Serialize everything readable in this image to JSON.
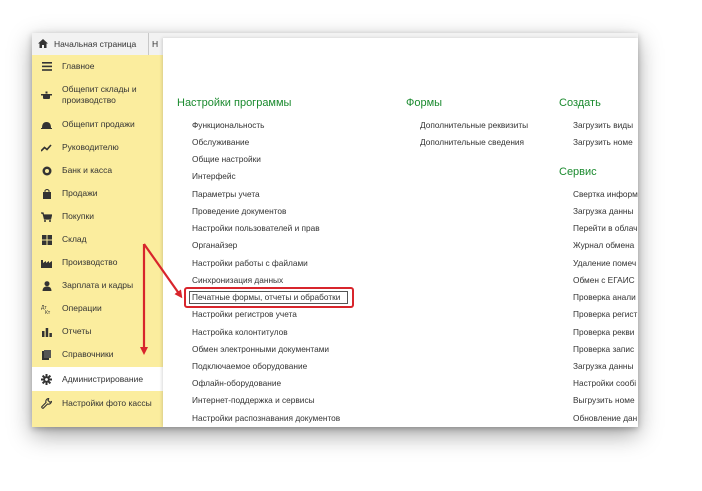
{
  "tabs": {
    "home": "Начальная страница",
    "next": "Н"
  },
  "sidebar": {
    "items": [
      {
        "label": "Главное",
        "icon": "menu-lines-icon"
      },
      {
        "label": "Общепит склады и производство",
        "icon": "cooking-pot-icon"
      },
      {
        "label": "Общепит продажи",
        "icon": "serving-dish-icon"
      },
      {
        "label": "Руководителю",
        "icon": "trend-chart-icon"
      },
      {
        "label": "Банк и касса",
        "icon": "coin-icon"
      },
      {
        "label": "Продажи",
        "icon": "shopping-bag-icon"
      },
      {
        "label": "Покупки",
        "icon": "cart-icon"
      },
      {
        "label": "Склад",
        "icon": "warehouse-grid-icon"
      },
      {
        "label": "Производство",
        "icon": "factory-icon"
      },
      {
        "label": "Зарплата и кадры",
        "icon": "person-icon"
      },
      {
        "label": "Операции",
        "icon": "debit-credit-icon"
      },
      {
        "label": "Отчеты",
        "icon": "bar-chart-icon"
      },
      {
        "label": "Справочники",
        "icon": "books-icon"
      },
      {
        "label": "Администрирование",
        "icon": "gear-icon"
      },
      {
        "label": "Настройки фото кассы",
        "icon": "wrench-icon"
      }
    ],
    "active_item": "Администрирование"
  },
  "menu": {
    "settings": {
      "title": "Настройки программы",
      "items": [
        "Функциональность",
        "Обслуживание",
        "Общие настройки",
        "Интерфейс",
        "Параметры учета",
        "Проведение документов",
        "Настройки пользователей и прав",
        "Органайзер",
        "Настройки работы с файлами",
        "Синхронизация данных",
        "Печатные формы, отчеты и обработки",
        "Настройки регистров учета",
        "Настройка колонтитулов",
        "Обмен электронными документами",
        "Подключаемое оборудование",
        "Офлайн-оборудование",
        "Интернет-поддержка и сервисы",
        "Настройки распознавания документов"
      ],
      "highlighted": "Печатные формы, отчеты и обработки"
    },
    "forms": {
      "title": "Формы",
      "items": [
        "Дополнительные реквизиты",
        "Дополнительные сведения"
      ]
    },
    "create": {
      "title": "Создать",
      "items": [
        "Загрузить виды",
        "Загрузить номе"
      ]
    },
    "service": {
      "title": "Сервис",
      "items": [
        "Свертка информ",
        "Загрузка данны",
        "Перейти в облач",
        "Журнал обмена",
        "Удаление помеч",
        "Обмен с ЕГАИС",
        "Проверка анали",
        "Проверка регист",
        "Проверка рекви",
        "Проверка запис",
        "Загрузка данны",
        "Настройки сообі",
        "Выгрузить номе",
        "Обновление дан"
      ]
    }
  },
  "colors": {
    "sidebar_bg": "#fbed9e",
    "section_title": "#1a8a2e",
    "annotation_red": "#d8252c"
  }
}
